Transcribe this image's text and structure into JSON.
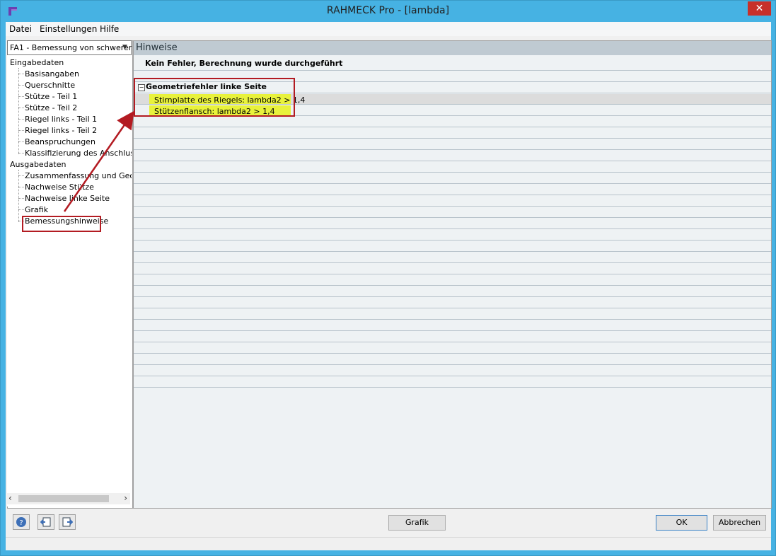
{
  "window": {
    "title": "RAHMECK Pro - [lambda]",
    "close_label": "✕"
  },
  "menu": {
    "items": [
      "Datei",
      "Einstellungen",
      "Hilfe"
    ]
  },
  "case_select": {
    "value": "FA1 - Bemessung von schwerer"
  },
  "tree": {
    "input_group": "Eingabedaten",
    "input_items": [
      "Basisangaben",
      "Querschnitte",
      "Stütze - Teil 1",
      "Stütze - Teil 2",
      "Riegel links - Teil 1",
      "Riegel links - Teil 2",
      "Beanspruchungen",
      "Klassifizierung des Anschlusses"
    ],
    "output_group": "Ausgabedaten",
    "output_items": [
      "Zusammenfassung und Geometrie",
      "Nachweise Stütze",
      "Nachweise linke Seite",
      "Grafik",
      "Bemessungshinweise"
    ]
  },
  "main": {
    "header": "Hinweise",
    "status_message": "Kein Fehler, Berechnung wurde durchgeführt",
    "group_title": "Geometriefehler linke Seite",
    "group_toggle": "−",
    "messages": [
      "Stirnplatte des Riegels: lambda2 > 1,4",
      "Stützenflansch: lambda2 > 1,4"
    ]
  },
  "buttons": {
    "graphic": "Grafik",
    "ok": "OK",
    "cancel": "Abbrechen"
  },
  "icons": {
    "help": "help-icon",
    "import": "import-icon",
    "export": "export-icon"
  },
  "colors": {
    "highlight": "#e8f23c",
    "annotation": "#b31b22",
    "titlebar": "#46b2e3"
  }
}
